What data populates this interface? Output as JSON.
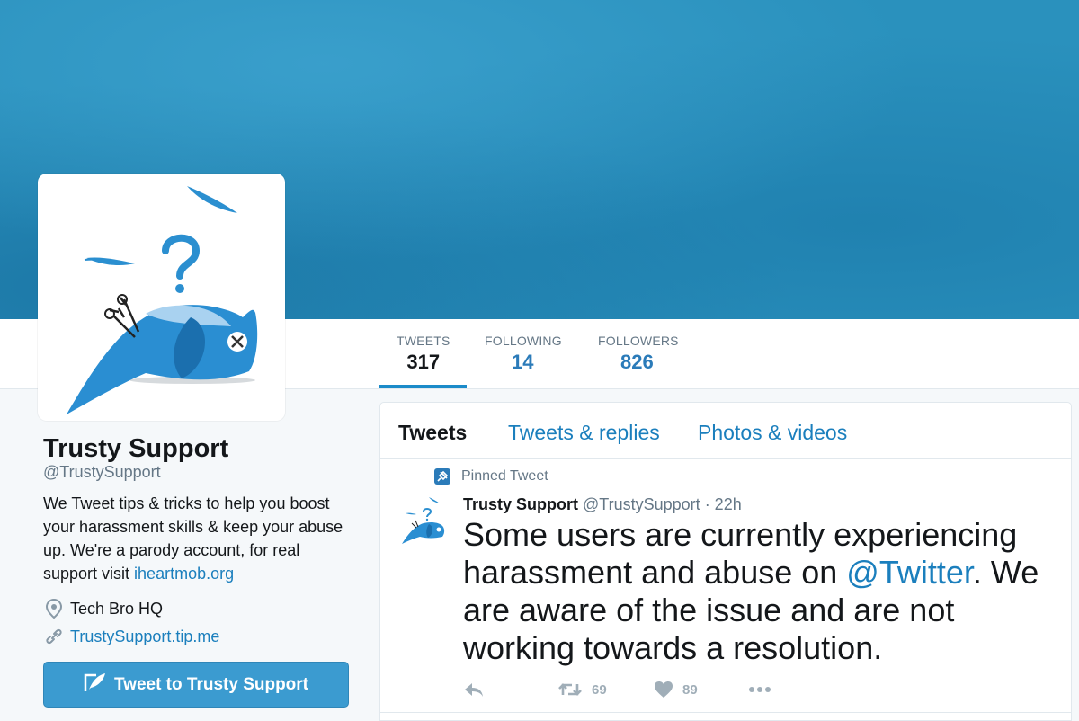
{
  "colors": {
    "banner": "#2a91bd",
    "link": "#1b7fbd",
    "accent": "#1b8bc9",
    "muted": "#657786",
    "button": "#3b9bd0"
  },
  "stats": [
    {
      "label": "TWEETS",
      "value": "317"
    },
    {
      "label": "FOLLOWING",
      "value": "14"
    },
    {
      "label": "FOLLOWERS",
      "value": "826"
    }
  ],
  "profile": {
    "name": "Trusty Support",
    "handle": "@TrustySupport",
    "bio_text": "We Tweet tips & tricks to help you boost your harassment skills & keep your abuse up. We're a parody account, for real support visit ",
    "bio_link": "iheartmob.org",
    "location": "Tech Bro HQ",
    "website": "TrustySupport.tip.me",
    "tweet_to_button": "Tweet to Trusty Support",
    "avatar_icon": "dead-bird-icon"
  },
  "tabs": [
    "Tweets",
    "Tweets & replies",
    "Photos & videos"
  ],
  "tweet": {
    "pinned_label": "Pinned Tweet",
    "author": "Trusty Support",
    "handle": "@TrustySupport",
    "time": " · 22h",
    "text_before": "Some users are currently experiencing harassment and abuse on ",
    "mention": "@Twitter",
    "text_after": ". We are aware of the issue and are not working towards a resolution.",
    "retweets": "69",
    "likes": "89"
  }
}
